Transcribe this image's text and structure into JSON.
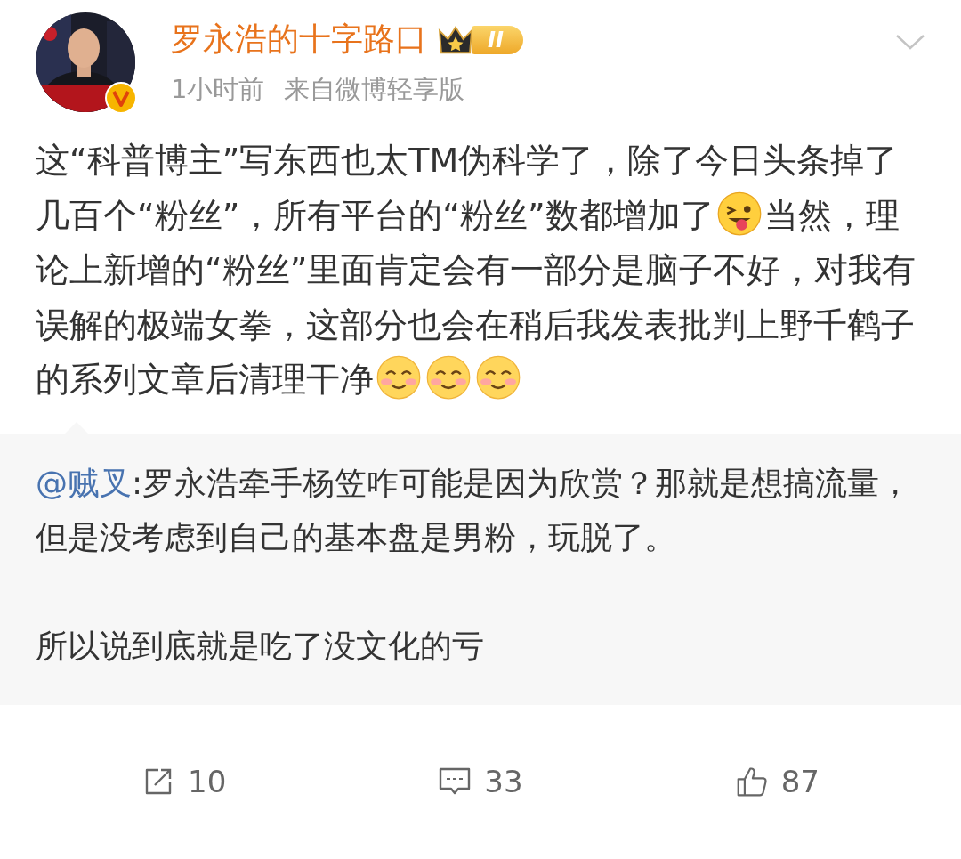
{
  "post": {
    "author": "罗永浩的十字路口",
    "level_badge": "II",
    "verified": true,
    "time": "1小时前",
    "source": "来自微博轻享版",
    "body": [
      {
        "kind": "text",
        "text": "这“科普博主”写东西也太TM伪科学了，除了今日头条掉了几百个“粉丝”，所有平台的“粉丝”数都增加了"
      },
      {
        "kind": "wink_emoji"
      },
      {
        "kind": "text",
        "text": "当然，理论上新增的“粉丝”里面肯定会有一部分是脑子不好，对我有误解的极端女拳，这部分也会在稍后我发表批判上野千鹤子的系列文章后清理干净"
      },
      {
        "kind": "smile_emoji"
      },
      {
        "kind": "smile_emoji"
      },
      {
        "kind": "smile_emoji"
      }
    ],
    "repost": {
      "user": "@贼叉",
      "paragraphs": [
        ":罗永浩牵手杨笠咋可能是因为欣赏？那就是想搞流量，但是没考虑到自己的基本盘是男粉，玩脱了。",
        "所以说到底就是吃了没文化的亏"
      ]
    },
    "actions": [
      {
        "kind": "repost",
        "count": "10"
      },
      {
        "kind": "comment",
        "count": "33"
      },
      {
        "kind": "like",
        "count": "87"
      }
    ]
  }
}
